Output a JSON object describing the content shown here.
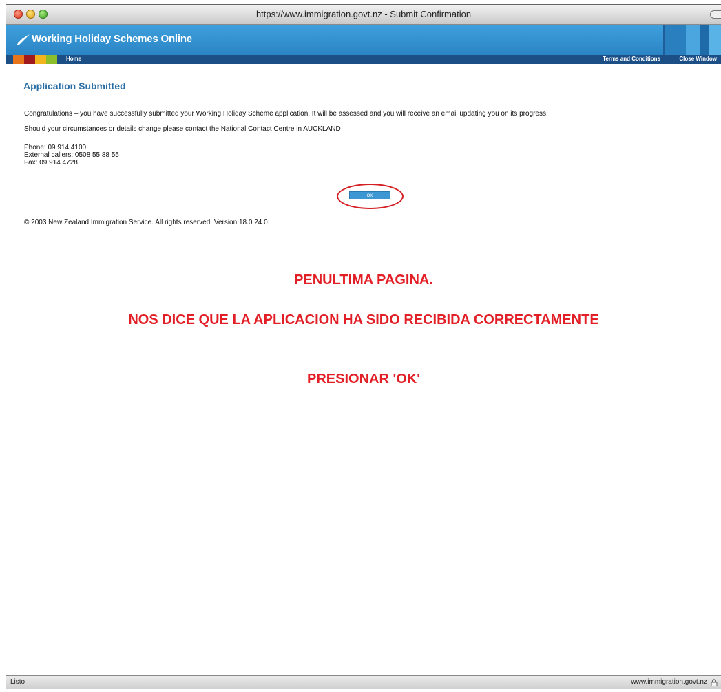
{
  "window": {
    "title": "https://www.immigration.govt.nz - Submit Confirmation"
  },
  "header": {
    "brand": "Working Holiday Schemes Online",
    "colors": {
      "banner": "#2b84c5",
      "navbar": "#1c4f86",
      "swatches": [
        "#e8751a",
        "#a0191d",
        "#f2b41c",
        "#8cbd2b"
      ]
    }
  },
  "nav": {
    "home": "Home",
    "terms": "Terms and Conditions",
    "close": "Close Window"
  },
  "main": {
    "title": "Application Submitted",
    "paragraph1": "Congratulations – you have successfully submitted your Working Holiday Scheme application. It will be assessed and you will receive an email updating you on its progress.",
    "paragraph2": "Should your circumstances or details change please contact the National Contact Centre in AUCKLAND",
    "phone": "Phone: 09 914 4100",
    "external": "External callers: 0508 55 88 55",
    "fax": "Fax: 09 914 4728",
    "ok_label": "OK",
    "copyright": "© 2003 New Zealand Immigration Service. All rights reserved. Version 18.0.24.0."
  },
  "annotations": {
    "line1": "PENULTIMA PAGINA.",
    "line2": "NOS DICE QUE LA APLICACION HA SIDO RECIBIDA CORRECTAMENTE",
    "line3": "PRESIONAR 'OK'",
    "color": "#e21f26"
  },
  "status": {
    "left": "Listo",
    "right": "www.immigration.govt.nz"
  }
}
